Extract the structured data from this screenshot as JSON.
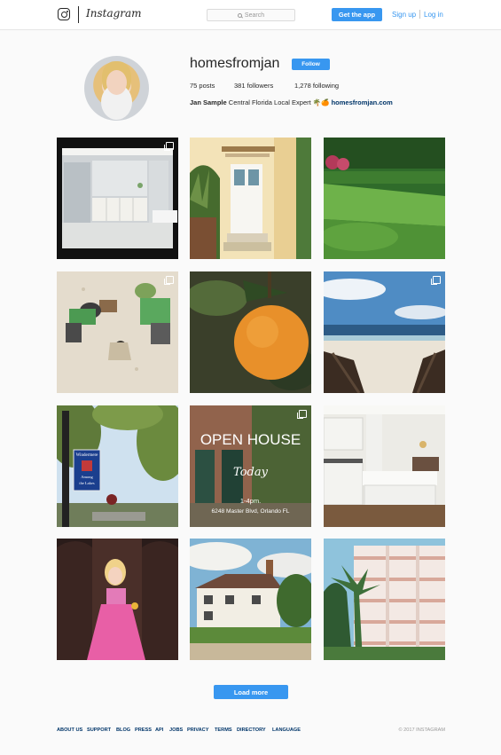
{
  "header": {
    "wordmark": "Instagram",
    "search_placeholder": "Search",
    "get_app": "Get the app",
    "sign_up": "Sign up",
    "log_in": "Log in"
  },
  "profile": {
    "username": "homesfromjan",
    "follow": "Follow",
    "posts": "75 posts",
    "followers": "381 followers",
    "following": "1,278 following",
    "bio_name": "Jan Sample",
    "bio_text": " Central Florida Local Expert 🌴🍊 ",
    "bio_link": "homesfromjan.com"
  },
  "posts": [
    {
      "subject": "bathroom"
    },
    {
      "subject": "white-door"
    },
    {
      "subject": "lawn"
    },
    {
      "subject": "sand-dig"
    },
    {
      "subject": "orange"
    },
    {
      "subject": "beach"
    },
    {
      "subject": "street-sign",
      "sign_lines": [
        "Windermere",
        "Among",
        "the Lakes"
      ]
    },
    {
      "subject": "open-house",
      "text_open": "OPEN HOUSE",
      "text_today": "Today",
      "text_time": "1-4pm.",
      "text_addr": "6248 Master Blvd, Orlando FL"
    },
    {
      "subject": "kitchen"
    },
    {
      "subject": "girl"
    },
    {
      "subject": "cottage"
    },
    {
      "subject": "condo"
    }
  ],
  "load_more": "Load more",
  "footer": {
    "links": [
      "ABOUT US",
      "SUPPORT",
      "BLOG",
      "PRESS",
      "API",
      "JOBS",
      "PRIVACY",
      "TERMS",
      "DIRECTORY",
      "LANGUAGE"
    ],
    "copyright": "© 2017 INSTAGRAM"
  },
  "colors": {
    "accent": "#3897f0",
    "link_dark": "#003569",
    "background": "#fafafa"
  }
}
